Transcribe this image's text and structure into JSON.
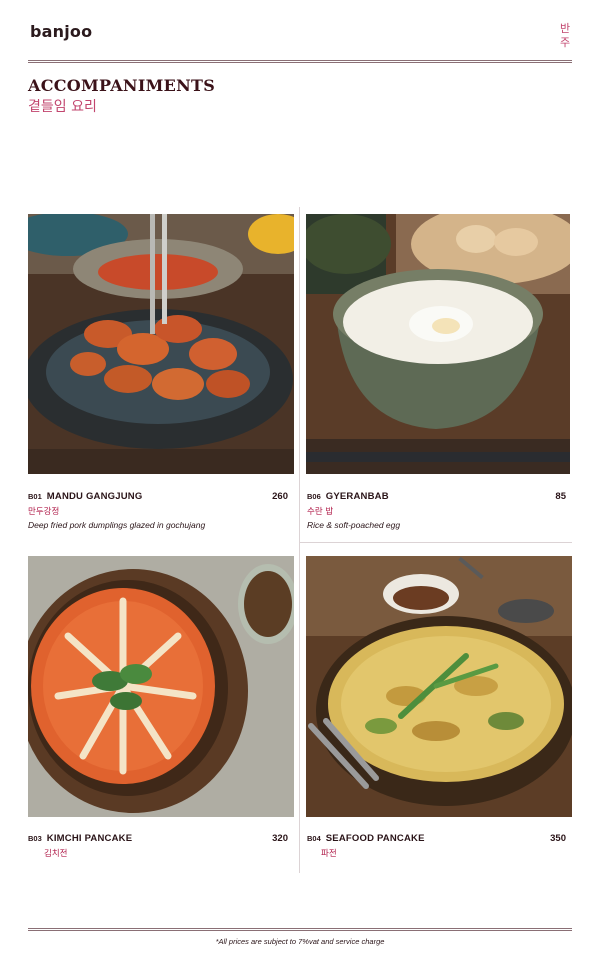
{
  "brand": {
    "name": "banjoo",
    "korean_1": "반",
    "korean_2": "주"
  },
  "section": {
    "title": "ACCOMPANIMENTS",
    "title_korean": "곁들임 요리"
  },
  "items": [
    {
      "code": "B01",
      "name": "MANDU GANGJUNG",
      "price": "260",
      "korean": "만두강정",
      "description": "Deep fried pork dumplings glazed in gochujang",
      "photo": "mandu-gangjung-photo"
    },
    {
      "code": "B06",
      "name": "GYERANBAB",
      "price": "85",
      "korean": "수란 밥",
      "description": "Rice & soft-poached egg",
      "photo": "gyeranbab-photo"
    },
    {
      "code": "B03",
      "name": "KIMCHI PANCAKE",
      "price": "320",
      "korean": "김치전",
      "description": "",
      "photo": "kimchi-pancake-photo"
    },
    {
      "code": "B04",
      "name": "SEAFOOD PANCAKE",
      "price": "350",
      "korean": "파전",
      "description": "",
      "photo": "seafood-pancake-photo"
    }
  ],
  "footer": {
    "note": "*All prices are subject to 7%vat and service charge"
  },
  "colors": {
    "brand_pink": "#c2456e",
    "korean_red": "#b01d4a",
    "title": "#3b1219",
    "rule": "#8a6f75"
  }
}
